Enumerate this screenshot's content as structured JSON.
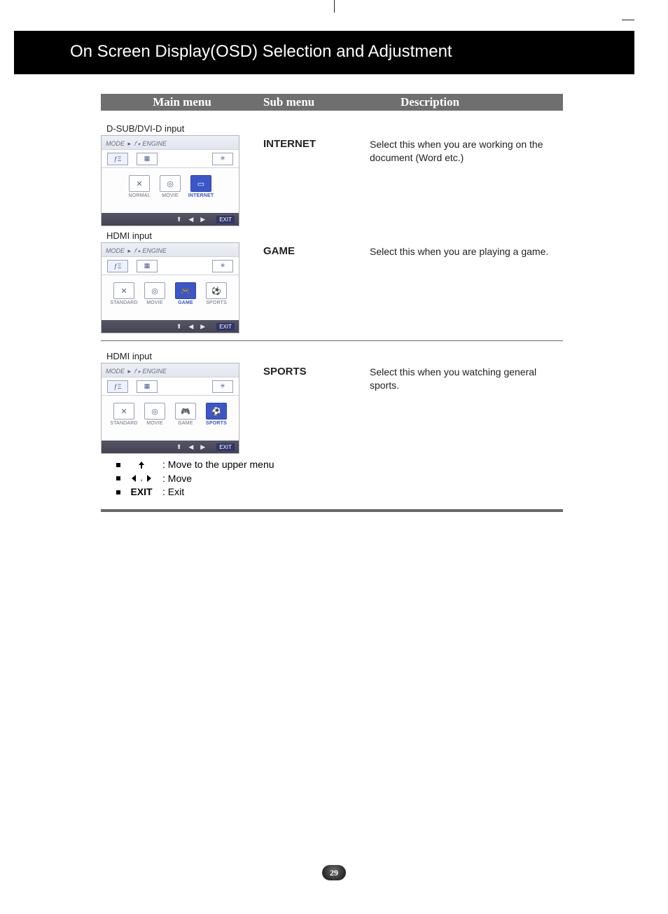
{
  "page": {
    "title": "On Screen Display(OSD) Selection and Adjustment",
    "number": "29"
  },
  "table_header": {
    "col1": "Main menu",
    "col2": "Sub menu",
    "col3": "Description"
  },
  "osd_common": {
    "breadcrumb_mode": "MODE",
    "breadcrumb_engine": "𝑓 ▸ ENGINE",
    "footer_exit": "EXIT"
  },
  "sections": [
    {
      "input_label": "D-SUB/DVI-D input",
      "sub_menu": "INTERNET",
      "description": "Select this when you are working on the document (Word etc.)",
      "osd": {
        "modes": [
          {
            "cap": "NORMAL",
            "glyph": "✕",
            "selected": false
          },
          {
            "cap": "MOVIE",
            "glyph": "◎",
            "selected": false
          },
          {
            "cap": "INTERNET",
            "glyph": "▭",
            "selected": true
          }
        ]
      }
    },
    {
      "input_label": "HDMI input",
      "sub_menu": "GAME",
      "description": "Select this when you are playing a game.",
      "osd": {
        "modes": [
          {
            "cap": "STANDARD",
            "glyph": "✕",
            "selected": false
          },
          {
            "cap": "MOVIE",
            "glyph": "◎",
            "selected": false
          },
          {
            "cap": "GAME",
            "glyph": "🎮",
            "selected": true
          },
          {
            "cap": "SPORTS",
            "glyph": "⚽",
            "selected": false
          }
        ]
      }
    },
    {
      "input_label": "HDMI input",
      "sub_menu": "SPORTS",
      "description": "Select this when you watching general sports.",
      "osd": {
        "modes": [
          {
            "cap": "STANDARD",
            "glyph": "✕",
            "selected": false
          },
          {
            "cap": "MOVIE",
            "glyph": "◎",
            "selected": false
          },
          {
            "cap": "GAME",
            "glyph": "🎮",
            "selected": false
          },
          {
            "cap": "SPORTS",
            "glyph": "⚽",
            "selected": true
          }
        ]
      }
    }
  ],
  "legend": {
    "up": ": Move to the upper menu",
    "move": ": Move",
    "exit_label": "EXIT",
    "exit": ": Exit"
  }
}
